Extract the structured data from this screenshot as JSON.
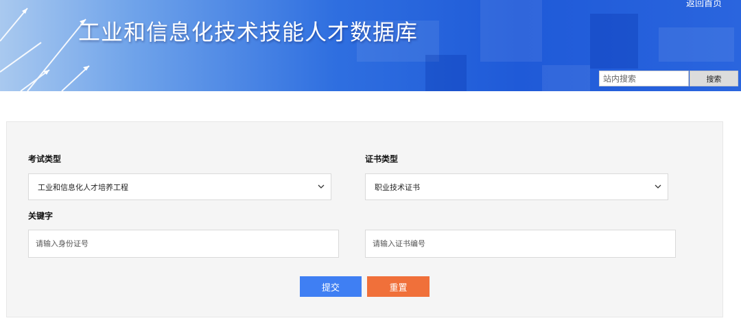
{
  "header": {
    "site_title": "工业和信息化技术技能人才数据库",
    "home_link": "返回首页",
    "search": {
      "placeholder": "站内搜索",
      "button_label": "搜索"
    }
  },
  "form": {
    "exam_type": {
      "label": "考试类型",
      "selected": "工业和信息化人才培养工程"
    },
    "cert_type": {
      "label": "证书类型",
      "selected": "职业技术证书"
    },
    "keyword": {
      "label": "关键字",
      "id_placeholder": "请输入身份证号",
      "cert_no_placeholder": "请输入证书编号"
    },
    "submit_label": "提交",
    "reset_label": "重置"
  },
  "colors": {
    "banner": "#2f6fe0",
    "submit_button": "#3f7ff3",
    "reset_button": "#f0703a",
    "panel": "#f5f5f5"
  }
}
